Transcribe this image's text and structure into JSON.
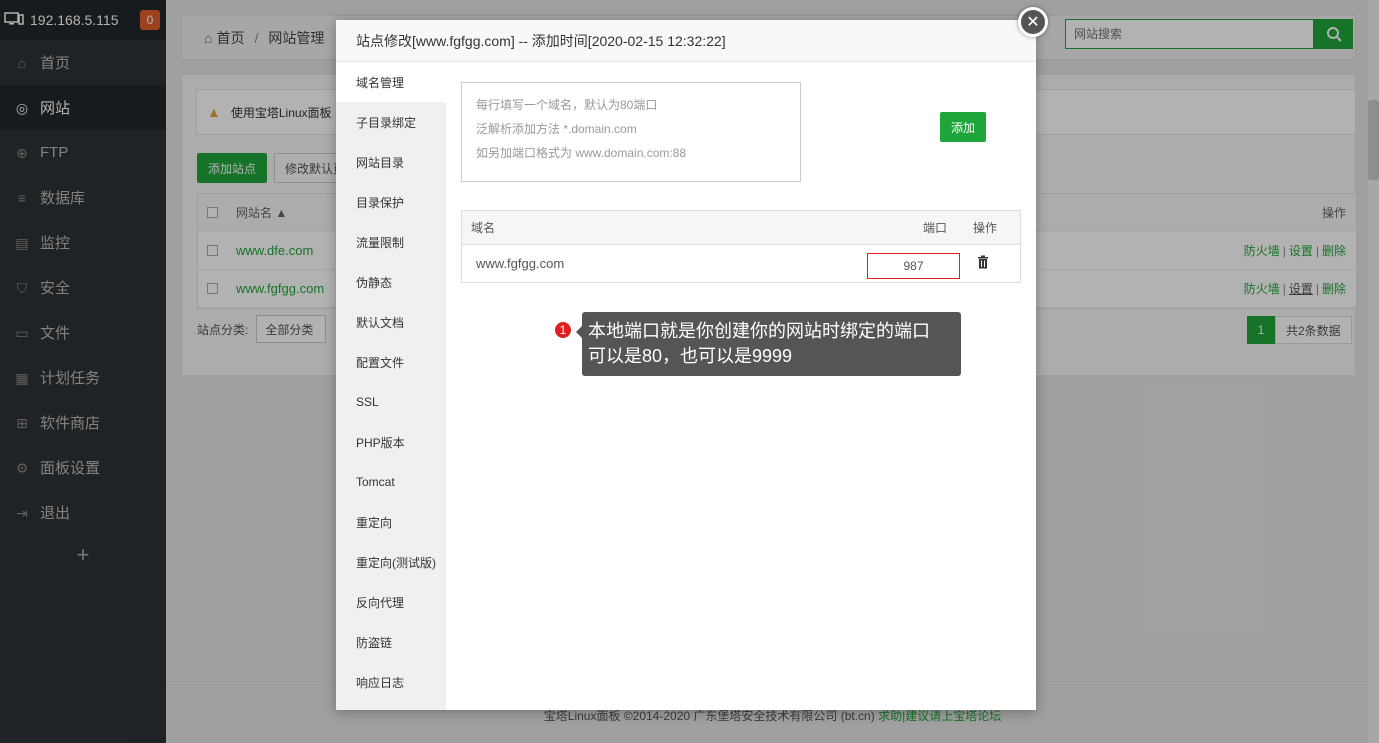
{
  "sidebar": {
    "ip": "192.168.5.115",
    "badge": "0",
    "items": [
      {
        "label": "首页",
        "icon": "home-icon"
      },
      {
        "label": "网站",
        "icon": "globe-icon"
      },
      {
        "label": "FTP",
        "icon": "ftp-icon"
      },
      {
        "label": "数据库",
        "icon": "database-icon"
      },
      {
        "label": "监控",
        "icon": "monitor-icon"
      },
      {
        "label": "安全",
        "icon": "shield-icon"
      },
      {
        "label": "文件",
        "icon": "folder-icon"
      },
      {
        "label": "计划任务",
        "icon": "calendar-icon"
      },
      {
        "label": "软件商店",
        "icon": "apps-icon"
      },
      {
        "label": "面板设置",
        "icon": "gear-icon"
      },
      {
        "label": "退出",
        "icon": "logout-icon"
      }
    ],
    "plus": "+"
  },
  "header": {
    "home": "首页",
    "separator": "/",
    "current": "网站管理",
    "search_placeholder": "网站搜索"
  },
  "panel": {
    "warning": "使用宝塔Linux面板",
    "add_site": "添加站点",
    "modify_default": "修改默认页",
    "col_name": "网站名 ▲",
    "col_ops": "操作",
    "rows": [
      {
        "name": "www.dfe.com",
        "op1": "防火墙",
        "op2": "设置",
        "op3": "删除"
      },
      {
        "name": "www.fgfgg.com",
        "op1": "防火墙",
        "op2": "设置",
        "op3": "删除"
      }
    ],
    "category_label": "站点分类:",
    "category_value": "全部分类",
    "page": "1",
    "total": "共2条数据"
  },
  "footer": {
    "text": "宝塔Linux面板 ©2014-2020 广东堡塔安全技术有限公司 (bt.cn)",
    "link": "求助|建议请上宝塔论坛"
  },
  "modal": {
    "title": "站点修改[www.fgfgg.com] -- 添加时间[2020-02-15 12:32:22]",
    "close": "✕",
    "tabs": [
      "域名管理",
      "子目录绑定",
      "网站目录",
      "目录保护",
      "流量限制",
      "伪静态",
      "默认文档",
      "配置文件",
      "SSL",
      "PHP版本",
      "Tomcat",
      "重定向",
      "重定向(测试版)",
      "反向代理",
      "防盗链",
      "响应日志"
    ],
    "placeholder_line1": "每行填写一个域名，默认为80端口",
    "placeholder_line2": "泛解析添加方法 *.domain.com",
    "placeholder_line3": "如另加端口格式为 www.domain.com:88",
    "add_button": "添加",
    "col_domain": "域名",
    "col_port": "端口",
    "col_ops": "操作",
    "domain": "www.fgfgg.com",
    "port": "987"
  },
  "annotation": {
    "number": "1",
    "line1": "本地端口就是你创建你的网站时绑定的端口",
    "line2": "可以是80，也可以是9999"
  },
  "colors": {
    "accent": "#20a53a",
    "sidebar": "#2f3337",
    "highlight": "#e02020"
  }
}
